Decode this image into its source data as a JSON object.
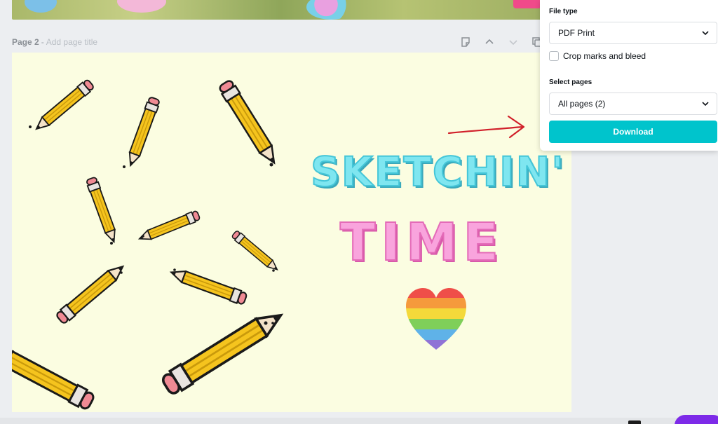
{
  "page2": {
    "label": "Page 2",
    "dash": "-",
    "title_placeholder": "Add page title"
  },
  "design": {
    "heading_line1": "SKETCHIN'",
    "heading_line2": "TIME",
    "colors": {
      "background": "#fbfde1",
      "sketchin": "#7fe6f0",
      "time": "#f9a4dd"
    }
  },
  "download_panel": {
    "file_type_label": "File type",
    "file_type_value": "PDF Print",
    "crop_marks_label": "Crop marks and bleed",
    "crop_marks_checked": false,
    "select_pages_label": "Select pages",
    "select_pages_value": "All pages (2)",
    "download_label": "Download",
    "accent_color": "#00c4cc"
  },
  "icons": {
    "page_tools": [
      "note-icon",
      "chevron-up-icon",
      "chevron-down-icon",
      "duplicate-icon"
    ],
    "dropdown": "chevron-down-icon"
  },
  "annotation_color": "#d1202a"
}
